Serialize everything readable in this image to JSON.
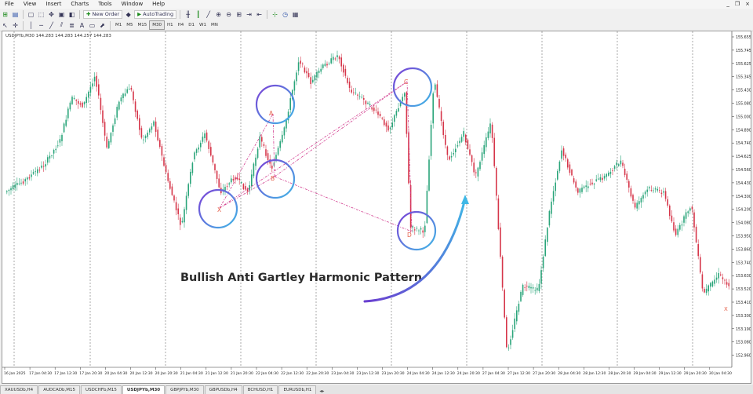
{
  "menu": {
    "items": [
      "File",
      "View",
      "Insert",
      "Charts",
      "Tools",
      "Window",
      "Help"
    ],
    "window_controls": [
      "_",
      "❐",
      "×"
    ]
  },
  "toolbar": {
    "new_order": "New Order",
    "auto_trading": "AutoTrading",
    "timeframes": [
      "M1",
      "M5",
      "M15",
      "M30",
      "H1",
      "H4",
      "D1",
      "W1",
      "MN"
    ],
    "active_timeframe": "M30"
  },
  "chart": {
    "info": "USDJPYb,M30  144.283 144.283 144.257 144.283",
    "annotation": "Bullish Anti Gartley Harmonic Pattern",
    "pattern_points": [
      "X",
      "A",
      "B",
      "C",
      "D"
    ],
    "right_label": "X",
    "price_labels": [
      "155.655",
      "155.745",
      "155.625",
      "155.345",
      "155.430",
      "155.080",
      "155.000",
      "154.890",
      "154.740",
      "154.625",
      "154.560",
      "154.430",
      "154.300",
      "154.200",
      "154.080",
      "153.950",
      "153.860",
      "153.740",
      "153.630",
      "153.520",
      "153.410",
      "153.300",
      "153.190",
      "153.080",
      "152.960"
    ],
    "time_labels": [
      "16 Jan 2025",
      "17 Jan 04:30",
      "17 Jan 12:30",
      "17 Jan 20:30",
      "20 Jan 04:30",
      "20 Jan 12:30",
      "20 Jan 20:30",
      "21 Jan 04:30",
      "21 Jan 12:30",
      "21 Jan 20:30",
      "22 Jan 04:30",
      "22 Jan 12:30",
      "22 Jan 20:30",
      "23 Jan 04:30",
      "23 Jan 12:30",
      "23 Jan 20:30",
      "24 Jan 04:30",
      "24 Jan 12:30",
      "24 Jan 20:30",
      "27 Jan 04:30",
      "27 Jan 12:30",
      "27 Jan 20:30",
      "28 Jan 04:30",
      "28 Jan 12:30",
      "28 Jan 20:30",
      "29 Jan 04:30",
      "29 Jan 12:30",
      "29 Jan 20:30",
      "30 Jan 04:30"
    ]
  },
  "tabs": {
    "items": [
      "XAUUSDb,H4",
      "AUDCADb,M15",
      "USDCHFb,M15",
      "USDJPYb,M30",
      "GBPJPYb,M30",
      "GBPUSDb,H4",
      "BCHUSD,H1",
      "EURUSDb,H1"
    ],
    "active": "USDJPYb,M30"
  },
  "colors": {
    "bull": "#2aa57a",
    "bear": "#d6364a",
    "circle_a": "#7b3fd6",
    "circle_b": "#3fb8e6",
    "pattern_line": "#d23d8f",
    "arrow": "#6a3fd0"
  }
}
